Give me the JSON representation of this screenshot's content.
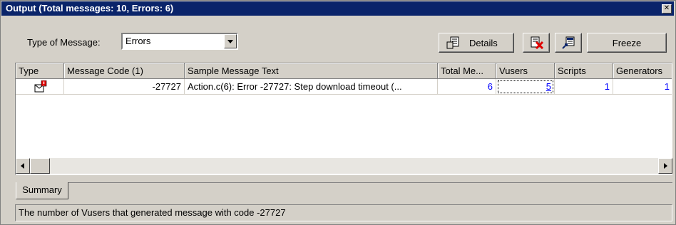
{
  "window": {
    "title": "Output (Total messages: 10, Errors: 6)"
  },
  "toolbar": {
    "type_label": "Type of Message:",
    "type_value": "Errors",
    "details_label": "Details",
    "freeze_label": "Freeze"
  },
  "table": {
    "columns": [
      "Type",
      "Message Code (1)",
      "Sample Message Text",
      "Total Me...",
      "Vusers",
      "Scripts",
      "Generators"
    ],
    "rows": [
      {
        "type_icon": "error-message-icon",
        "code": "-27727",
        "text": "Action.c(6): Error -27727: Step download timeout (...",
        "total": "6",
        "vusers": "5",
        "scripts": "1",
        "generators": "1"
      }
    ]
  },
  "tabs": [
    "Summary"
  ],
  "status": "The number of Vusers that generated message with code -27727",
  "colors": {
    "title_bg": "#0a246a",
    "link": "#0000ff",
    "face": "#d4d0c8"
  }
}
